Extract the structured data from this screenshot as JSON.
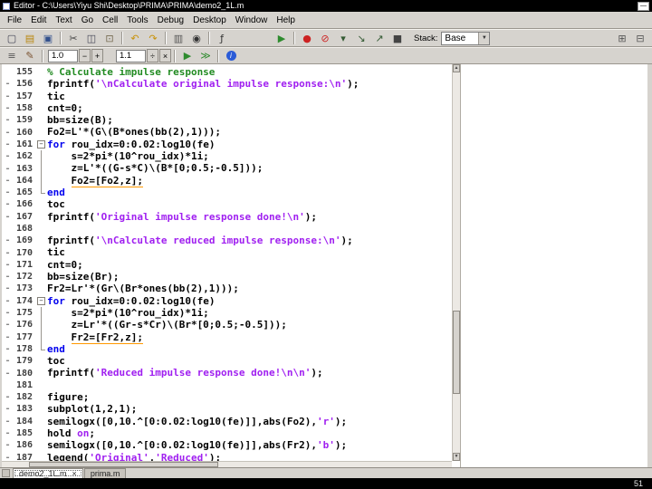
{
  "slide": {
    "page_number": "51"
  },
  "window": {
    "title": "Editor - C:\\Users\\Yiyu Shi\\Desktop\\PRIMA\\PRIMA\\demo2_1L.m",
    "minimize_glyph": "—"
  },
  "menu": {
    "items": [
      "File",
      "Edit",
      "Text",
      "Go",
      "Cell",
      "Tools",
      "Debug",
      "Desktop",
      "Window",
      "Help"
    ]
  },
  "glyphs": {
    "combo_arrow": "▼",
    "scroll_up": "▲",
    "scroll_down": "▼",
    "fold_collapse": "−",
    "tab_close": "×"
  },
  "toolbar": {
    "stack_label": "Stack:",
    "stack_value": "Base",
    "left_buttons": [
      {
        "b": "new-file",
        "g": "▢",
        "c": "#445"
      },
      {
        "b": "open-file",
        "g": "▤",
        "c": "#b8860b"
      },
      {
        "b": "save",
        "g": "▣",
        "c": "#33518c"
      },
      {
        "sep": true
      },
      {
        "b": "cut",
        "g": "✂",
        "c": "#444"
      },
      {
        "b": "copy",
        "g": "◫",
        "c": "#445"
      },
      {
        "b": "paste",
        "g": "⊡",
        "c": "#756a50"
      },
      {
        "sep": true
      },
      {
        "b": "undo",
        "g": "↶",
        "c": "#c8920a"
      },
      {
        "b": "redo",
        "g": "↷",
        "c": "#c8920a"
      },
      {
        "sep": true
      },
      {
        "b": "print",
        "g": "▥",
        "c": "#555"
      },
      {
        "b": "find",
        "g": "◉",
        "c": "#333"
      },
      {
        "sep": true
      },
      {
        "b": "goto-function",
        "g": "ƒ",
        "c": "#333"
      },
      {
        "gap": 46
      },
      {
        "b": "run",
        "g": "▶",
        "c": "#2e8b2e"
      },
      {
        "sep": true
      },
      {
        "b": "set-clear-breakpoint",
        "g": "●",
        "c": "#cc2222"
      },
      {
        "b": "clear-all-breakpoints",
        "g": "⊘",
        "c": "#cc2222"
      },
      {
        "b": "step",
        "g": "▾",
        "c": "#335a33"
      },
      {
        "b": "step-in",
        "g": "↘",
        "c": "#335a33"
      },
      {
        "b": "step-out",
        "g": "↗",
        "c": "#335a33"
      },
      {
        "b": "exit-debug",
        "g": "■",
        "c": "#444"
      }
    ],
    "right_buttons": [
      {
        "b": "dock",
        "g": "⊞",
        "c": "#555"
      },
      {
        "b": "tile-windows",
        "g": "⊟",
        "c": "#555"
      }
    ]
  },
  "cell_toolbar": {
    "value1": "1.0",
    "value2": "1.1",
    "minus": "−",
    "plus": "+",
    "divide": "÷",
    "multiply": "×",
    "left_buttons": [
      {
        "b": "insert-cell-divider",
        "g": "≡",
        "c": "#555"
      },
      {
        "b": "edit-cell",
        "g": "✎",
        "c": "#7a5230"
      }
    ],
    "mid_buttons": [
      {
        "b": "evaluate-cell",
        "g": "▶",
        "c": "#2e8b2e"
      },
      {
        "b": "evaluate-cell-advance",
        "g": "≫",
        "c": "#2e8b2e"
      }
    ],
    "info": {
      "b": "help-info",
      "g": "i",
      "c": "#ffffff"
    }
  },
  "tabs": [
    {
      "label": "demo2_1L.m",
      "active": true
    },
    {
      "label": "prima.m",
      "active": false
    }
  ],
  "editor": {
    "lines": [
      {
        "n": "155",
        "f": "",
        "d": false,
        "t": [
          [
            "c",
            "% Calculate impulse response"
          ]
        ]
      },
      {
        "n": "156",
        "f": "",
        "d": true,
        "t": [
          [
            "p",
            "fprintf("
          ],
          [
            "s",
            "'\\nCalculate original impulse response:\\n'"
          ],
          [
            "p",
            ");"
          ]
        ]
      },
      {
        "n": "157",
        "f": "",
        "d": true,
        "t": [
          [
            "p",
            "tic"
          ]
        ]
      },
      {
        "n": "158",
        "f": "",
        "d": true,
        "t": [
          [
            "p",
            "cnt=0;"
          ]
        ]
      },
      {
        "n": "159",
        "f": "",
        "d": true,
        "t": [
          [
            "p",
            "bb=size(B);"
          ]
        ]
      },
      {
        "n": "160",
        "f": "",
        "d": true,
        "t": [
          [
            "p",
            "Fo2=L'*(G\\(B*ones(bb(2),1)));"
          ]
        ]
      },
      {
        "n": "161",
        "f": "s",
        "d": true,
        "t": [
          [
            "k",
            "for"
          ],
          [
            "p",
            " rou_idx=0:0.02:log10(fe)"
          ]
        ]
      },
      {
        "n": "162",
        "f": "m",
        "d": true,
        "t": [
          [
            "p",
            "    s=2*pi*(10^rou_idx)*1i;"
          ]
        ]
      },
      {
        "n": "163",
        "f": "m",
        "d": true,
        "t": [
          [
            "p",
            "    z=L'*((G-s*C)\\(B*[0;0.5;-0.5]));"
          ]
        ]
      },
      {
        "n": "164",
        "f": "m",
        "d": true,
        "t": [
          [
            "p",
            "    "
          ],
          [
            "w",
            "Fo2=[Fo2,z];"
          ]
        ]
      },
      {
        "n": "165",
        "f": "e",
        "d": true,
        "t": [
          [
            "k",
            "end"
          ]
        ]
      },
      {
        "n": "166",
        "f": "",
        "d": true,
        "t": [
          [
            "p",
            "toc"
          ]
        ]
      },
      {
        "n": "167",
        "f": "",
        "d": true,
        "t": [
          [
            "p",
            "fprintf("
          ],
          [
            "s",
            "'Original impulse response done!\\n'"
          ],
          [
            "p",
            ");"
          ]
        ]
      },
      {
        "n": "168",
        "f": "",
        "d": false,
        "t": []
      },
      {
        "n": "169",
        "f": "",
        "d": true,
        "t": [
          [
            "p",
            "fprintf("
          ],
          [
            "s",
            "'\\nCalculate reduced impulse response:\\n'"
          ],
          [
            "p",
            ");"
          ]
        ]
      },
      {
        "n": "170",
        "f": "",
        "d": true,
        "t": [
          [
            "p",
            "tic"
          ]
        ]
      },
      {
        "n": "171",
        "f": "",
        "d": true,
        "t": [
          [
            "p",
            "cnt=0;"
          ]
        ]
      },
      {
        "n": "172",
        "f": "",
        "d": true,
        "t": [
          [
            "p",
            "bb=size(Br);"
          ]
        ]
      },
      {
        "n": "173",
        "f": "",
        "d": true,
        "t": [
          [
            "p",
            "Fr2=Lr'*(Gr\\(Br*ones(bb(2),1)));"
          ]
        ]
      },
      {
        "n": "174",
        "f": "s",
        "d": true,
        "t": [
          [
            "k",
            "for"
          ],
          [
            "p",
            " rou_idx=0:0.02:log10(fe)"
          ]
        ]
      },
      {
        "n": "175",
        "f": "m",
        "d": true,
        "t": [
          [
            "p",
            "    s=2*pi*(10^rou_idx)*1i;"
          ]
        ]
      },
      {
        "n": "176",
        "f": "m",
        "d": true,
        "t": [
          [
            "p",
            "    z=Lr'*((Gr-s*Cr)\\(Br*[0;0.5;-0.5]));"
          ]
        ]
      },
      {
        "n": "177",
        "f": "m",
        "d": true,
        "t": [
          [
            "p",
            "    "
          ],
          [
            "w",
            "Fr2=[Fr2,z];"
          ]
        ]
      },
      {
        "n": "178",
        "f": "e",
        "d": true,
        "t": [
          [
            "k",
            "end"
          ]
        ]
      },
      {
        "n": "179",
        "f": "",
        "d": true,
        "t": [
          [
            "p",
            "toc"
          ]
        ]
      },
      {
        "n": "180",
        "f": "",
        "d": true,
        "t": [
          [
            "p",
            "fprintf("
          ],
          [
            "s",
            "'Reduced impulse response done!\\n\\n'"
          ],
          [
            "p",
            ");"
          ]
        ]
      },
      {
        "n": "181",
        "f": "",
        "d": false,
        "t": []
      },
      {
        "n": "182",
        "f": "",
        "d": true,
        "t": [
          [
            "p",
            "figure;"
          ]
        ]
      },
      {
        "n": "183",
        "f": "",
        "d": true,
        "t": [
          [
            "p",
            "subplot(1,2,1);"
          ]
        ]
      },
      {
        "n": "184",
        "f": "",
        "d": true,
        "t": [
          [
            "p",
            "semilogx([0,10.^[0:0.02:log10(fe)]],abs(Fo2),"
          ],
          [
            "s",
            "'r'"
          ],
          [
            "p",
            ");"
          ]
        ]
      },
      {
        "n": "185",
        "f": "",
        "d": true,
        "t": [
          [
            "p",
            "hold "
          ],
          [
            "s",
            "on"
          ],
          [
            "p",
            ";"
          ]
        ]
      },
      {
        "n": "186",
        "f": "",
        "d": true,
        "t": [
          [
            "p",
            "semilogx([0,10.^[0:0.02:log10(fe)]],abs(Fr2),"
          ],
          [
            "s",
            "'b'"
          ],
          [
            "p",
            ");"
          ]
        ]
      },
      {
        "n": "187",
        "f": "",
        "d": true,
        "t": [
          [
            "p",
            "legend("
          ],
          [
            "s",
            "'Original'"
          ],
          [
            "p",
            ","
          ],
          [
            "s",
            "'Reduced'"
          ],
          [
            "p",
            ");"
          ]
        ]
      }
    ]
  }
}
